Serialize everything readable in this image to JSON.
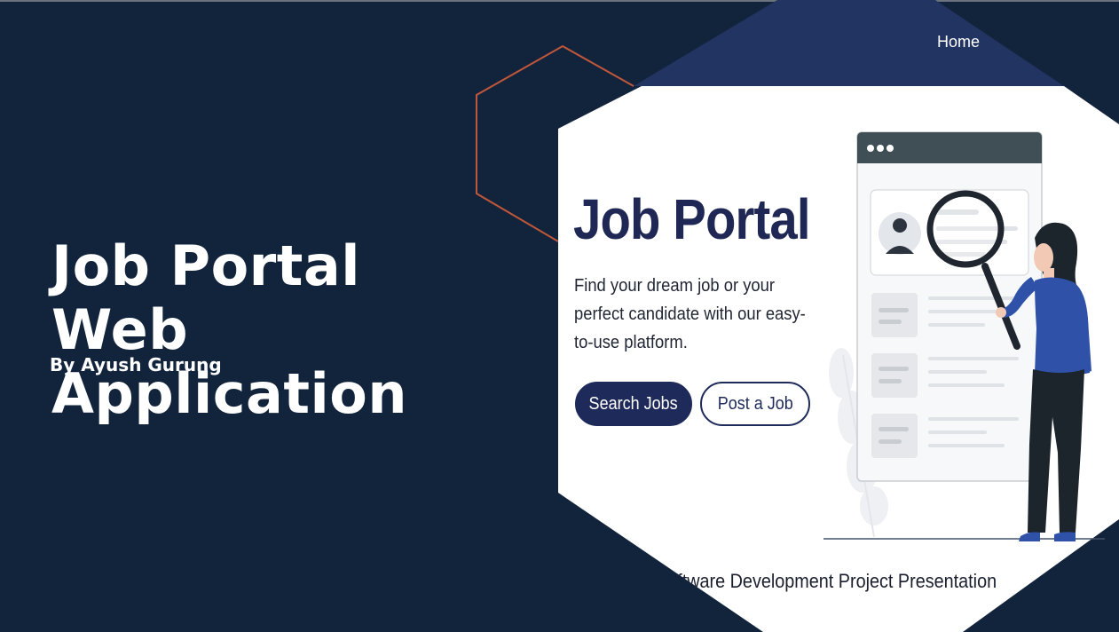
{
  "slide": {
    "title": "Job Portal Web Application",
    "author": "By Ayush Gurung"
  },
  "preview": {
    "nav": {
      "home_label": "Home"
    },
    "hero": {
      "heading": "Job Portal",
      "description": "Find your dream job or your perfect candidate with our easy-to-use platform.",
      "search_button": "Search Jobs",
      "post_button": "Post a Job"
    },
    "footer_text": "Software Development Project Presentation"
  },
  "colors": {
    "background": "#12233c",
    "nav_band": "#223562",
    "accent_hex_outline": "#c0573a",
    "brand_navy": "#1e2a5a",
    "illustration_blue": "#2f52a8"
  },
  "icons": {
    "window_dots": "three-dots-icon",
    "avatar": "person-avatar-icon",
    "magnifier": "magnifying-glass-icon"
  }
}
